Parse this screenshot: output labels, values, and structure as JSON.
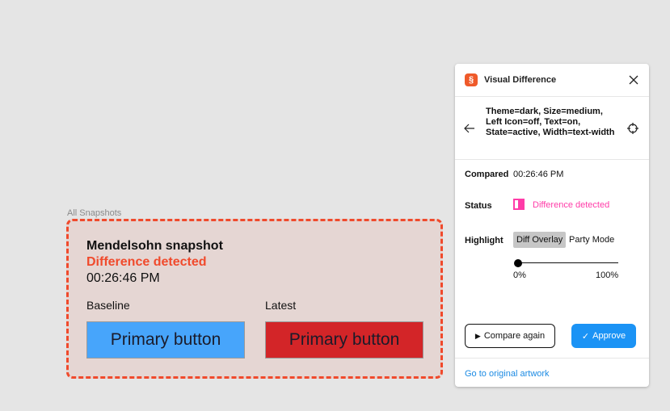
{
  "canvas": {
    "section_label": "All Snapshots",
    "snapshot": {
      "title": "Mendelsohn snapshot",
      "status": "Difference detected",
      "time": "00:26:46 PM",
      "baseline_label": "Baseline",
      "latest_label": "Latest",
      "baseline_button_text": "Primary button",
      "latest_button_text": "Primary button"
    }
  },
  "panel": {
    "logo_glyph": "§",
    "title": "Visual Difference",
    "close_icon": "×",
    "back_icon": "←",
    "target_icon": "⌖",
    "variant": "Theme=dark, Size=medium, Left Icon=off, Text=on, State=active, Width=text-width",
    "compared_label": "Compared",
    "compared_value": "00:26:46 PM",
    "status_label": "Status",
    "status_value": "Difference detected",
    "highlight_label": "Highlight",
    "highlight_options": [
      "Diff Overlay",
      "Party Mode"
    ],
    "highlight_selected": "Diff Overlay",
    "slider": {
      "value_percent": 0,
      "min_label": "0%",
      "max_label": "100%"
    },
    "compare_button": {
      "icon": "▶",
      "label": "Compare again"
    },
    "approve_button": {
      "icon": "✓",
      "label": "Approve"
    },
    "footer_link": "Go to original artwork"
  },
  "colors": {
    "accent_blue": "#1b93f5",
    "diff_pink": "#ff3ca8",
    "diff_red": "#f04a2c",
    "baseline_button": "#47a5fb",
    "latest_button": "#d32528"
  }
}
